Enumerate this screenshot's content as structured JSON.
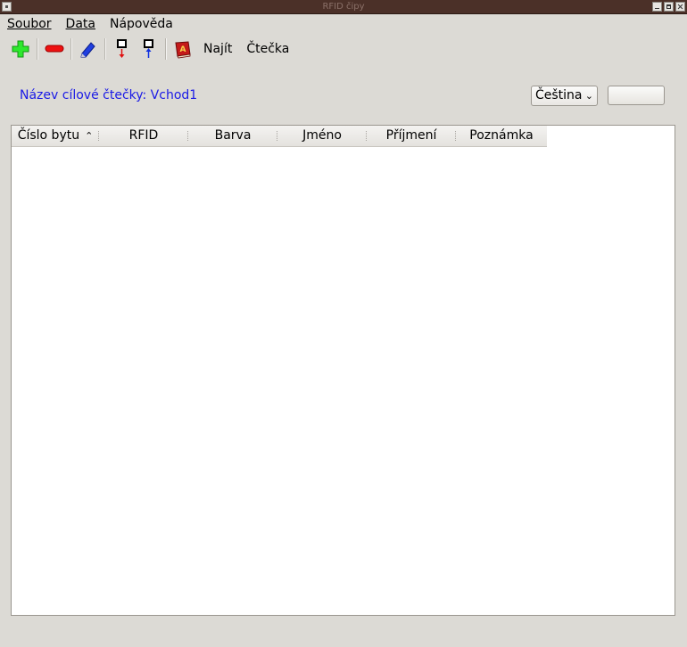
{
  "window": {
    "title": "RFID čipy"
  },
  "menu": {
    "soubor": "Soubor",
    "data": "Data",
    "napoveda": "Nápověda"
  },
  "toolbar": {
    "find_label": "Najít",
    "reader_label": "Čtečka"
  },
  "reader": {
    "label": "Název cílové čtečky: Vchod1"
  },
  "language": {
    "selected": "Čeština"
  },
  "table": {
    "columns": [
      "Číslo bytu",
      "RFID",
      "Barva",
      "Jméno",
      "Příjmení",
      "Poznámka"
    ],
    "rows": []
  },
  "colors": {
    "accent_text": "#1a1ae6",
    "titlebar": "#4b3028"
  }
}
